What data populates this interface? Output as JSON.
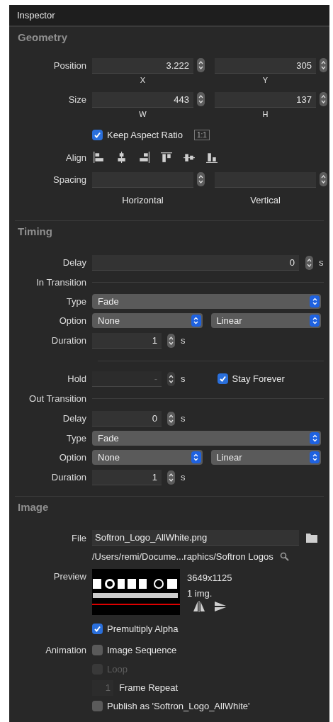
{
  "title": "Inspector",
  "sections": [
    {
      "heading": "Geometry",
      "rows": [
        {
          "kind": "pair",
          "label": "Position",
          "fields": [
            {
              "value": "3.222",
              "caption": "X"
            },
            {
              "value": "305",
              "caption": "Y"
            }
          ]
        },
        {
          "kind": "pair",
          "label": "Size",
          "fields": [
            {
              "value": "443",
              "caption": "W"
            },
            {
              "value": "137",
              "caption": "H"
            }
          ]
        },
        {
          "kind": "check",
          "text": "Keep Aspect Ratio",
          "checked": true,
          "disabled": false,
          "badge": "1:1"
        },
        {
          "kind": "align",
          "label": "Align"
        },
        {
          "kind": "pair",
          "label": "Spacing",
          "fields": [
            {
              "caption": "Horizontal"
            },
            {
              "caption": "Vertical"
            }
          ]
        }
      ]
    },
    {
      "heading": "Timing",
      "rows": [
        {
          "kind": "long_stepper",
          "label": "Delay",
          "value": "0",
          "unit": "s",
          "disabled": false
        },
        {
          "kind": "group",
          "label": "In Transition"
        },
        {
          "kind": "select",
          "label": "Type",
          "options": [
            {
              "value": "Fade"
            }
          ]
        },
        {
          "kind": "select",
          "label": "Option",
          "options": [
            {
              "value": "None"
            },
            {
              "value": "Linear"
            }
          ]
        },
        {
          "kind": "stepper",
          "label": "Duration",
          "value": "1",
          "unit": "s",
          "disabled": false
        },
        {
          "kind": "divider"
        },
        {
          "kind": "hold",
          "label": "Hold",
          "value": "-",
          "unit": "s",
          "disabled": true,
          "check": {
            "text": "Stay Forever",
            "checked": true
          }
        },
        {
          "kind": "group",
          "label": "Out Transition"
        },
        {
          "kind": "stepper",
          "label": "Delay",
          "value": "0",
          "unit": "s",
          "disabled": false
        },
        {
          "kind": "select",
          "label": "Type",
          "options": [
            {
              "value": "Fade"
            }
          ]
        },
        {
          "kind": "select",
          "label": "Option",
          "options": [
            {
              "value": "None"
            },
            {
              "value": "Linear"
            }
          ]
        },
        {
          "kind": "stepper",
          "label": "Duration",
          "value": "1",
          "unit": "s",
          "disabled": false
        }
      ]
    },
    {
      "heading": "Image",
      "rows": [
        {
          "kind": "file",
          "label": "File",
          "value": "Softron_Logo_AllWhite.png"
        },
        {
          "kind": "path",
          "text": "/Users/remi/Docume...raphics/Softron Logos"
        },
        {
          "kind": "preview",
          "label": "Preview",
          "dimensions": "3649x1125",
          "count": "1 img."
        },
        {
          "kind": "check",
          "text": "Premultiply Alpha",
          "checked": true,
          "disabled": false
        },
        {
          "kind": "check",
          "label": "Animation",
          "text": "Image Sequence",
          "checked": false,
          "disabled": false
        },
        {
          "kind": "check",
          "text": "Loop",
          "checked": false,
          "disabled": true
        },
        {
          "kind": "repeat",
          "value": "1",
          "text": "Frame Repeat",
          "disabled": true
        },
        {
          "kind": "check",
          "text": "Publish as 'Softron_Logo_AllWhite'",
          "checked": false,
          "disabled": false
        }
      ]
    }
  ]
}
